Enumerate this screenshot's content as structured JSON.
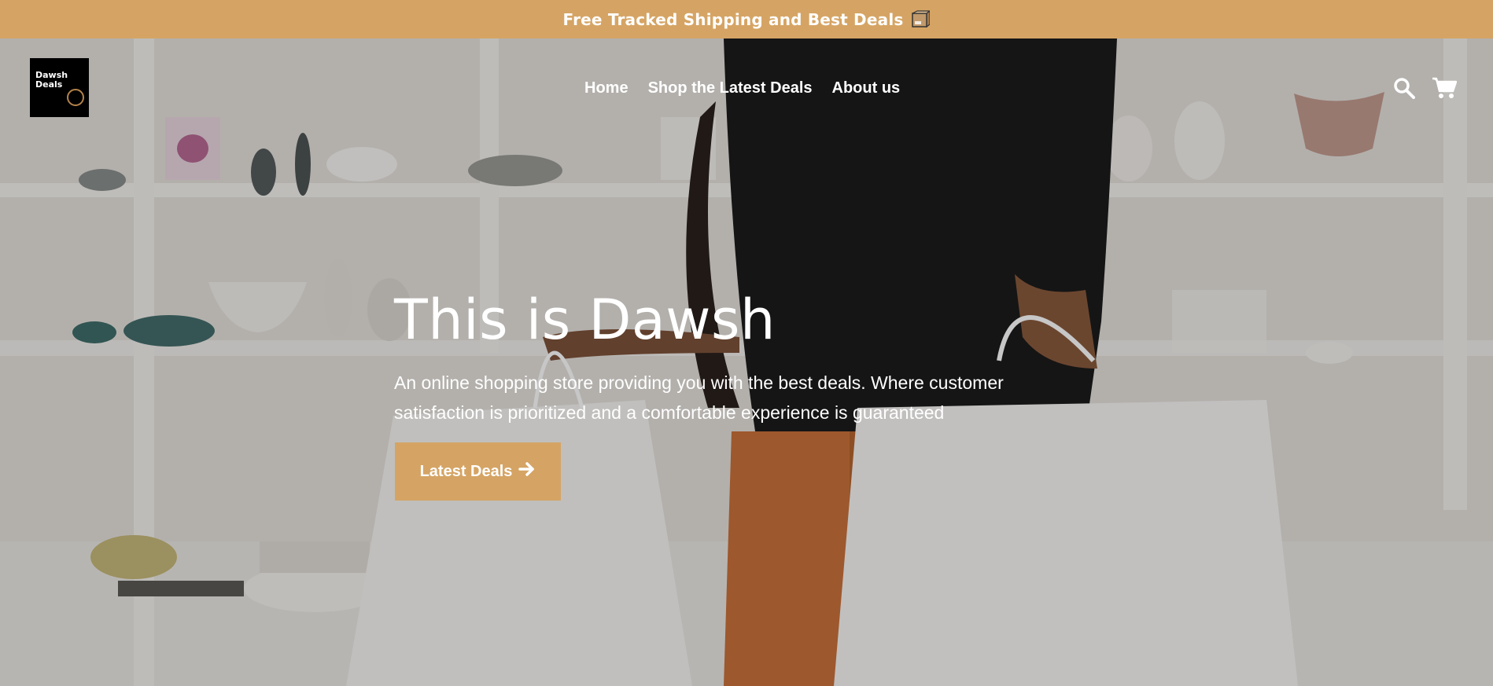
{
  "announcement": {
    "text": "Free Tracked Shipping and Best Deals",
    "icon": "package-box-icon"
  },
  "logo": {
    "line1": "Dawsh",
    "line2": "Deals"
  },
  "nav": {
    "items": [
      {
        "label": "Home"
      },
      {
        "label": "Shop the Latest Deals"
      },
      {
        "label": "About us"
      }
    ]
  },
  "header_icons": {
    "search": "search-icon",
    "cart": "cart-icon"
  },
  "hero": {
    "title": "This is Dawsh",
    "text": "An online shopping store providing you with the best deals. Where customer satisfaction is prioritized and a comfortable experience is guaranteed",
    "cta_label": "Latest Deals",
    "cta_icon": "arrow-right-icon"
  },
  "colors": {
    "accent": "#d5a464",
    "text_on_hero": "#ffffff"
  }
}
